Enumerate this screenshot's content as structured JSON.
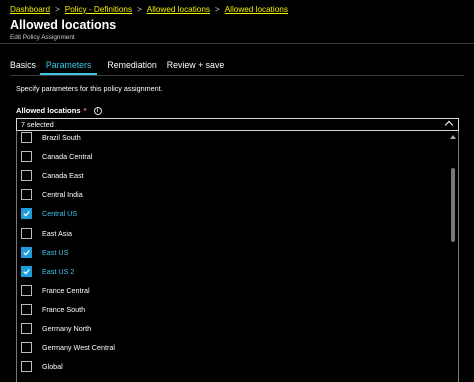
{
  "breadcrumb": {
    "items": [
      "Dashboard",
      "Policy - Definitions",
      "Allowed locations",
      "Allowed locations"
    ],
    "separator": ">"
  },
  "header": {
    "title": "Allowed locations",
    "subtitle": "Edit Policy Assignment"
  },
  "tabs": [
    {
      "label": "Basics",
      "active": false
    },
    {
      "label": "Parameters",
      "active": true
    },
    {
      "label": "Remediation",
      "active": false
    },
    {
      "label": "Review + save",
      "active": false
    }
  ],
  "parameters": {
    "description": "Specify parameters for this policy assignment.",
    "field_label": "Allowed locations",
    "required_mark": "*",
    "info_glyph": "i",
    "selected_value": "7 selected",
    "options": [
      {
        "label": "Brazil South",
        "checked": false
      },
      {
        "label": "Canada Central",
        "checked": false
      },
      {
        "label": "Canada East",
        "checked": false
      },
      {
        "label": "Central India",
        "checked": false
      },
      {
        "label": "Central US",
        "checked": true
      },
      {
        "label": "East Asia",
        "checked": false
      },
      {
        "label": "East US",
        "checked": true
      },
      {
        "label": "East US 2",
        "checked": true
      },
      {
        "label": "France Central",
        "checked": false
      },
      {
        "label": "France South",
        "checked": false
      },
      {
        "label": "Germany North",
        "checked": false
      },
      {
        "label": "Germany West Central",
        "checked": false
      },
      {
        "label": "Global",
        "checked": false
      }
    ]
  },
  "colors": {
    "link": "#f2f200",
    "accent": "#3cc7e8",
    "checkbox_checked": "#1e9cd9",
    "background": "#000000"
  },
  "icons": [
    "chevron-up-icon",
    "info-icon",
    "checkmark-icon"
  ]
}
